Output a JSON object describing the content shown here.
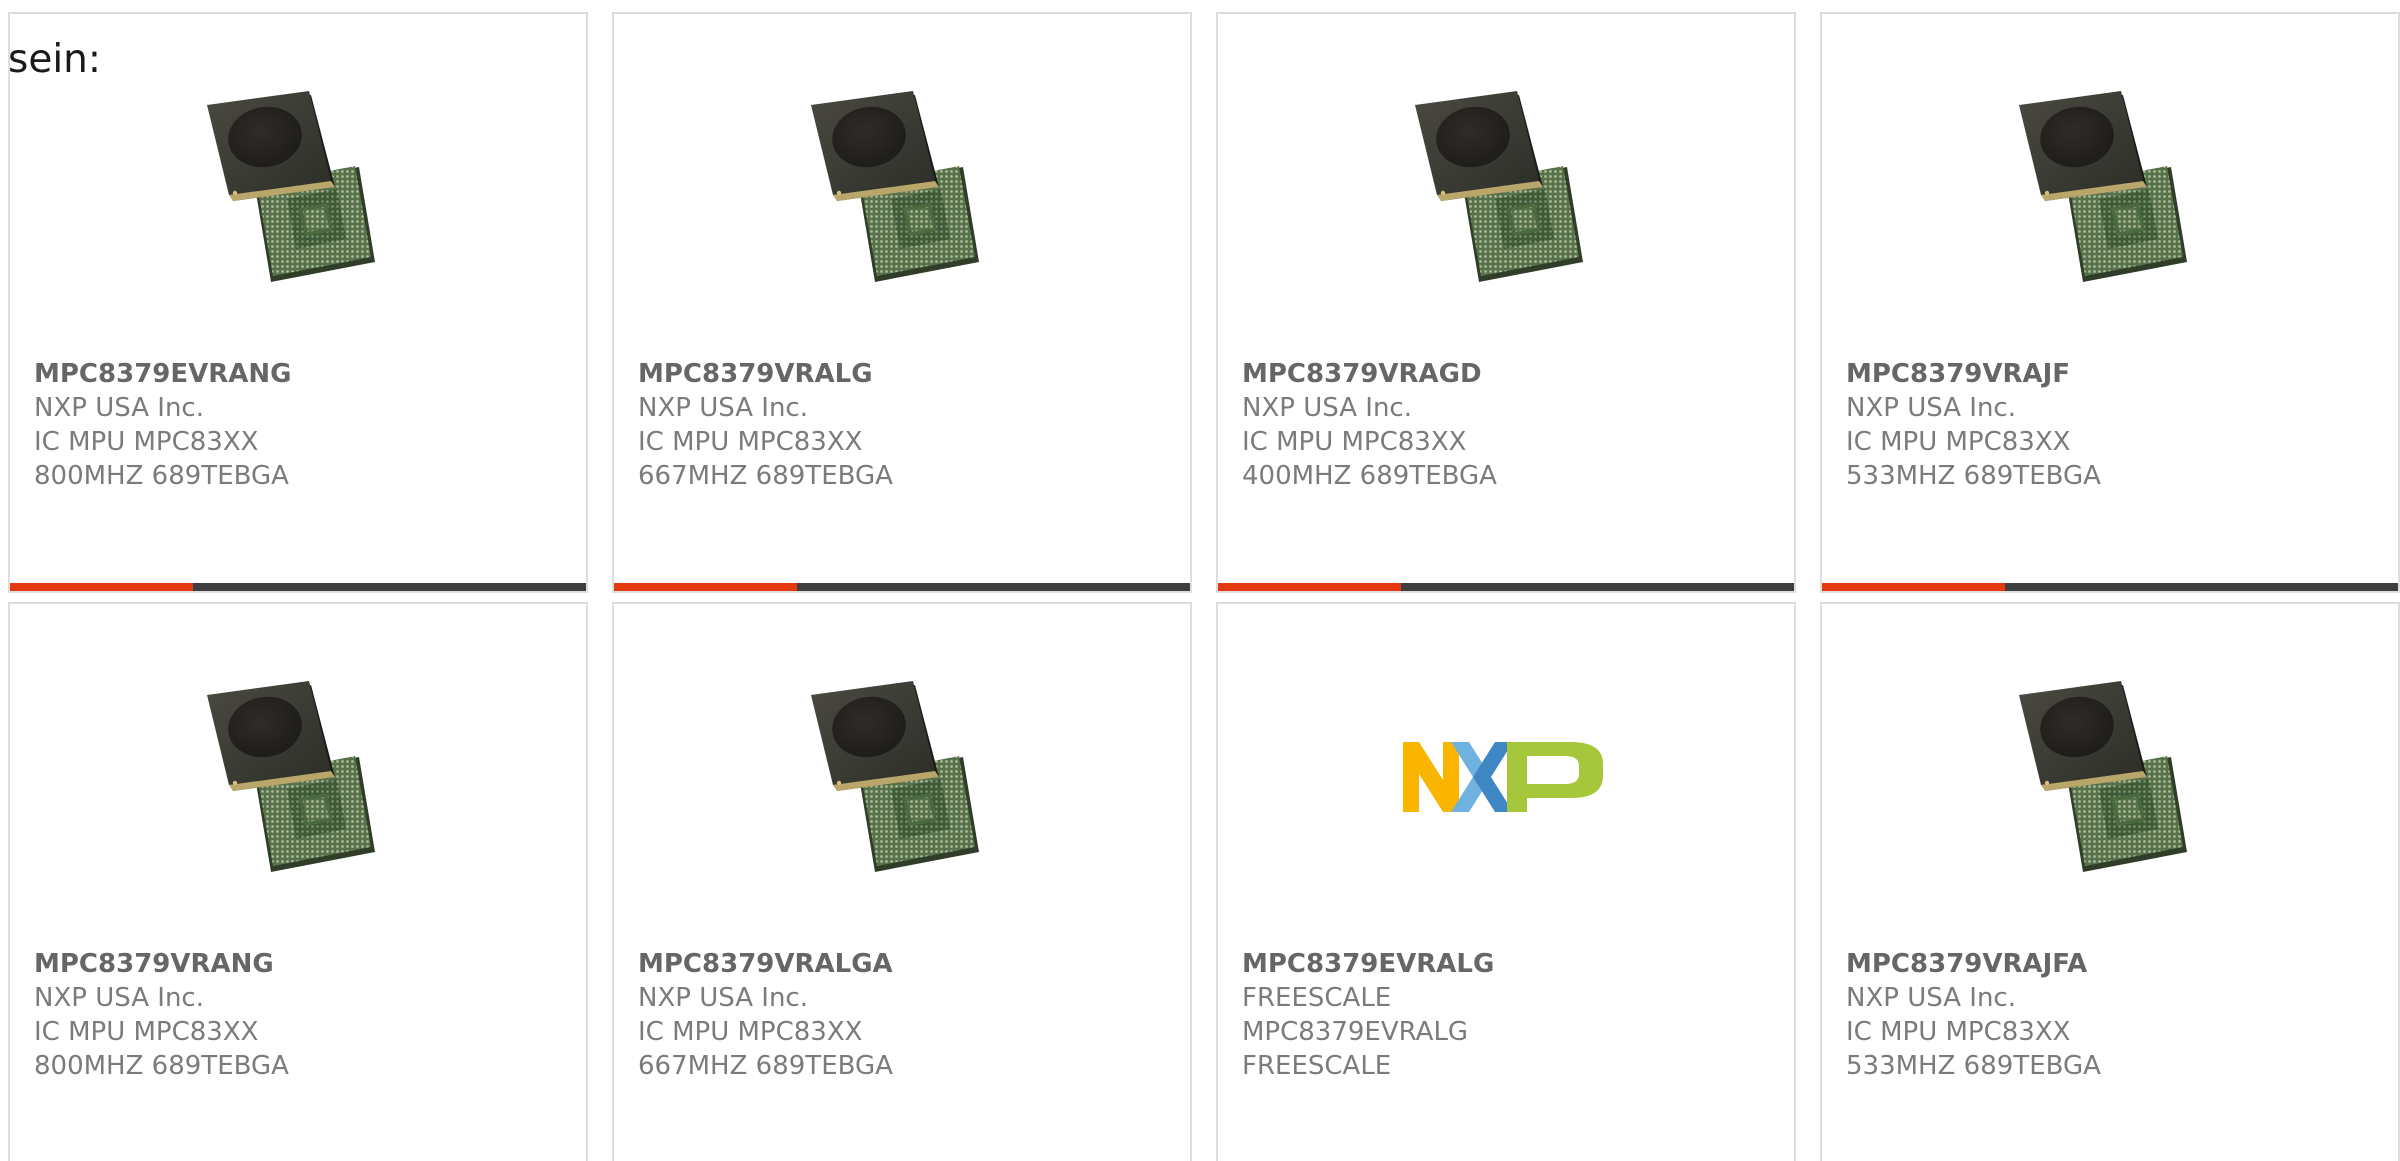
{
  "intro_text": "sein:",
  "colors": {
    "accent_bar": "#e4380f",
    "dark_bar": "#3f3f3f",
    "card_border": "#dedede",
    "text_muted": "#7b7b7b"
  },
  "products": [
    {
      "part_number": "MPC8379EVRANG",
      "manufacturer": "NXP USA Inc.",
      "description": "IC MPU MPC83XX 800MHZ 689TEBGA",
      "image": "bga-chip-image",
      "show_bar": true
    },
    {
      "part_number": "MPC8379VRALG",
      "manufacturer": "NXP USA Inc.",
      "description": "IC MPU MPC83XX 667MHZ 689TEBGA",
      "image": "bga-chip-image",
      "show_bar": true
    },
    {
      "part_number": "MPC8379VRAGD",
      "manufacturer": "NXP USA Inc.",
      "description": "IC MPU MPC83XX 400MHZ 689TEBGA",
      "image": "bga-chip-image",
      "show_bar": true
    },
    {
      "part_number": "MPC8379VRAJF",
      "manufacturer": "NXP USA Inc.",
      "description": "IC MPU MPC83XX 533MHZ 689TEBGA",
      "image": "bga-chip-image",
      "show_bar": true
    },
    {
      "part_number": "MPC8379VRANG",
      "manufacturer": "NXP USA Inc.",
      "description": "IC MPU MPC83XX 800MHZ 689TEBGA",
      "image": "bga-chip-image",
      "show_bar": false
    },
    {
      "part_number": "MPC8379VRALGA",
      "manufacturer": "NXP USA Inc.",
      "description": "IC MPU MPC83XX 667MHZ 689TEBGA",
      "image": "bga-chip-image",
      "show_bar": false
    },
    {
      "part_number": "MPC8379EVRALG",
      "manufacturer": "FREESCALE",
      "description": "MPC8379EVRALG FREESCALE",
      "image": "nxp-logo",
      "show_bar": false
    },
    {
      "part_number": "MPC8379VRAJFA",
      "manufacturer": "NXP USA Inc.",
      "description": "IC MPU MPC83XX 533MHZ 689TEBGA",
      "image": "bga-chip-image",
      "show_bar": false
    }
  ]
}
